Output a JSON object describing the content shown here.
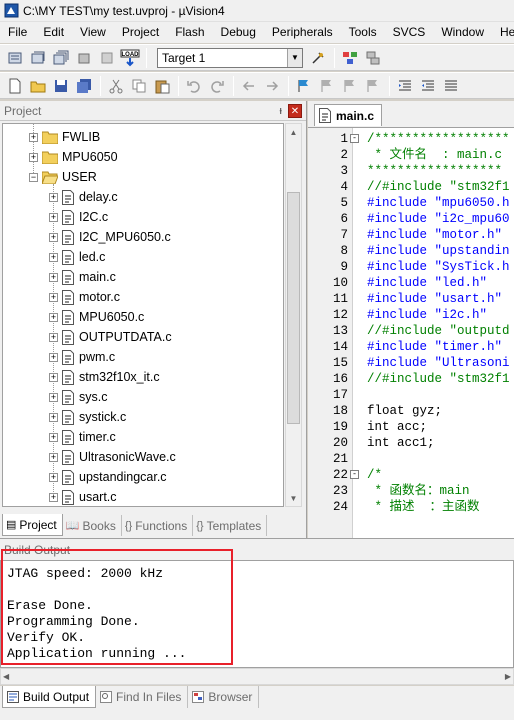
{
  "window": {
    "title": "C:\\MY TEST\\my test.uvproj - µVision4"
  },
  "menu": [
    "File",
    "Edit",
    "View",
    "Project",
    "Flash",
    "Debug",
    "Peripherals",
    "Tools",
    "SVCS",
    "Window",
    "Help"
  ],
  "toolbar": {
    "target_value": "Target 1",
    "load_label": "LOAD"
  },
  "project_panel": {
    "title": "Project",
    "folders": [
      "FWLIB",
      "MPU6050",
      "USER"
    ],
    "files": [
      "delay.c",
      "I2C.c",
      "I2C_MPU6050.c",
      "led.c",
      "main.c",
      "motor.c",
      "MPU6050.c",
      "OUTPUTDATA.c",
      "pwm.c",
      "stm32f10x_it.c",
      "sys.c",
      "systick.c",
      "timer.c",
      "UltrasonicWave.c",
      "upstandingcar.c",
      "usart.c"
    ],
    "tabs": [
      "Project",
      "Books",
      "Functions",
      "Templates"
    ]
  },
  "editor": {
    "tab_label": "main.c",
    "lines": [
      {
        "n": "1",
        "code": "/******************",
        "color": "#008000",
        "fold": "-"
      },
      {
        "n": "2",
        "code": " * 文件名  : main.c",
        "color": "#008000",
        "fold": ""
      },
      {
        "n": "3",
        "code": "******************",
        "color": "#008000",
        "fold": ""
      },
      {
        "n": "4",
        "code": "//#include \"stm32f1",
        "color": "#008000",
        "fold": ""
      },
      {
        "n": "5",
        "code": "#include \"mpu6050.h",
        "color": "#0000ff",
        "fold": ""
      },
      {
        "n": "6",
        "code": "#include \"i2c_mpu60",
        "color": "#0000ff",
        "fold": ""
      },
      {
        "n": "7",
        "code": "#include \"motor.h\"",
        "color": "#0000ff",
        "fold": ""
      },
      {
        "n": "8",
        "code": "#include \"upstandin",
        "color": "#0000ff",
        "fold": ""
      },
      {
        "n": "9",
        "code": "#include \"SysTick.h",
        "color": "#0000ff",
        "fold": ""
      },
      {
        "n": "10",
        "code": "#include \"led.h\"",
        "color": "#0000ff",
        "fold": ""
      },
      {
        "n": "11",
        "code": "#include \"usart.h\"",
        "color": "#0000ff",
        "fold": ""
      },
      {
        "n": "12",
        "code": "#include \"i2c.h\"",
        "color": "#0000ff",
        "fold": ""
      },
      {
        "n": "13",
        "code": "//#include \"outputd",
        "color": "#008000",
        "fold": ""
      },
      {
        "n": "14",
        "code": "#include \"timer.h\"",
        "color": "#0000ff",
        "fold": ""
      },
      {
        "n": "15",
        "code": "#include \"Ultrasoni",
        "color": "#0000ff",
        "fold": ""
      },
      {
        "n": "16",
        "code": "//#include \"stm32f1",
        "color": "#008000",
        "fold": ""
      },
      {
        "n": "17",
        "code": "",
        "color": "#000000",
        "fold": ""
      },
      {
        "n": "18",
        "code": "float gyz;",
        "color": "#000000",
        "fold": ""
      },
      {
        "n": "19",
        "code": "int acc;",
        "color": "#000000",
        "fold": ""
      },
      {
        "n": "20",
        "code": "int acc1;",
        "color": "#000000",
        "fold": ""
      },
      {
        "n": "21",
        "code": "",
        "color": "#000000",
        "fold": ""
      },
      {
        "n": "22",
        "code": "/*",
        "color": "#008000",
        "fold": "-"
      },
      {
        "n": "23",
        "code": " * 函数名：main",
        "color": "#008000",
        "fold": ""
      },
      {
        "n": "24",
        "code": " * 描述  ：主函数",
        "color": "#008000",
        "fold": ""
      }
    ]
  },
  "build_output": {
    "title": "Build Output",
    "lines": [
      "JTAG speed: 2000 kHz",
      "",
      "Erase Done.",
      "Programming Done.",
      "Verify OK.",
      "Application running ..."
    ]
  },
  "bottom_tabs": [
    "Build Output",
    "Find In Files",
    "Browser"
  ],
  "colors": {
    "highlight_box": "#e8202a",
    "comment": "#008000",
    "keyword": "#0000ff"
  }
}
